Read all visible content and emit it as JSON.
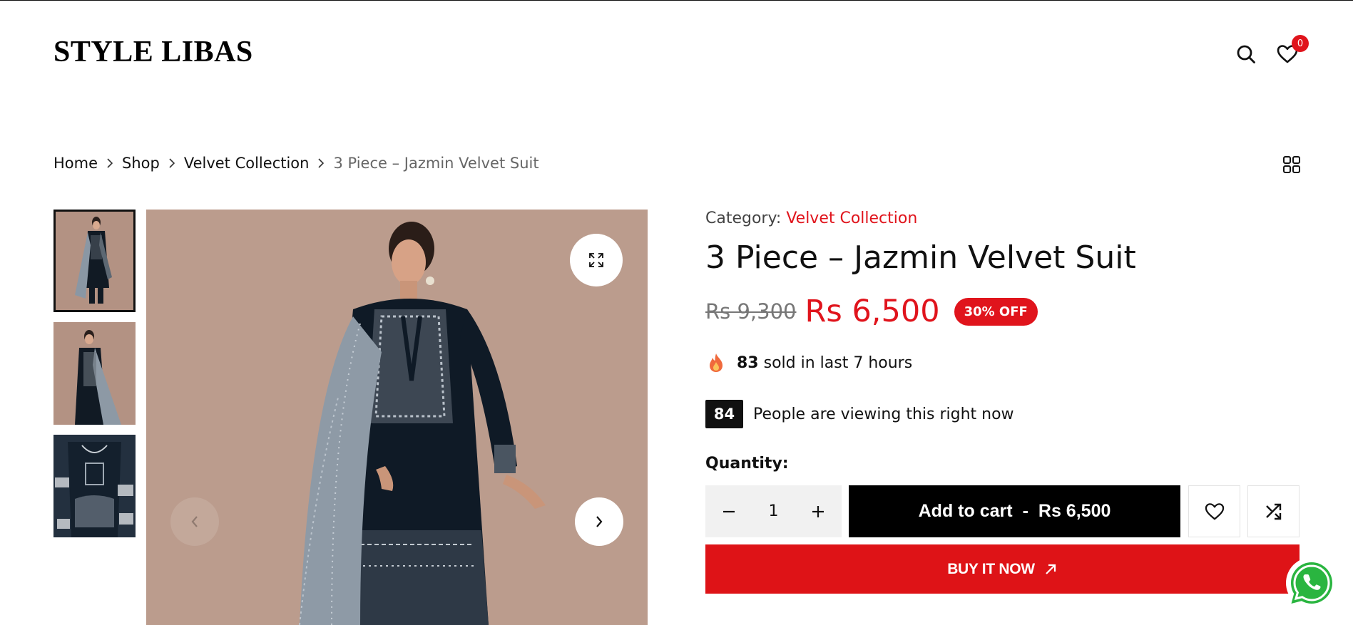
{
  "header": {
    "logo": "STYLE LIBAS",
    "search_icon": "search-icon",
    "wishlist_icon": "heart-icon",
    "wishlist_count": "0"
  },
  "breadcrumb": {
    "items": [
      "Home",
      "Shop",
      "Velvet Collection",
      "3 Piece – Jazmin Velvet Suit"
    ]
  },
  "gallery": {
    "thumbnail_count": 3,
    "active_index": 0
  },
  "product": {
    "category_label": "Category:",
    "category": "Velvet Collection",
    "title": "3 Piece – Jazmin Velvet Suit",
    "old_price": "Rs 9,300",
    "price": "Rs 6,500",
    "discount_badge": "30% OFF",
    "sold_count": "83",
    "sold_text": "sold in last 7 hours",
    "viewers_count": "84",
    "viewers_text": "People are viewing this right now",
    "quantity_label": "Quantity:",
    "quantity": "1",
    "add_to_cart_label": "Add to cart",
    "add_to_cart_separator": "-",
    "add_to_cart_price": "Rs 6,500",
    "buy_now_label": "BUY IT NOW"
  },
  "colors": {
    "accent_red": "#e0141c",
    "image_bg": "#bb9c8d",
    "black": "#000000"
  }
}
